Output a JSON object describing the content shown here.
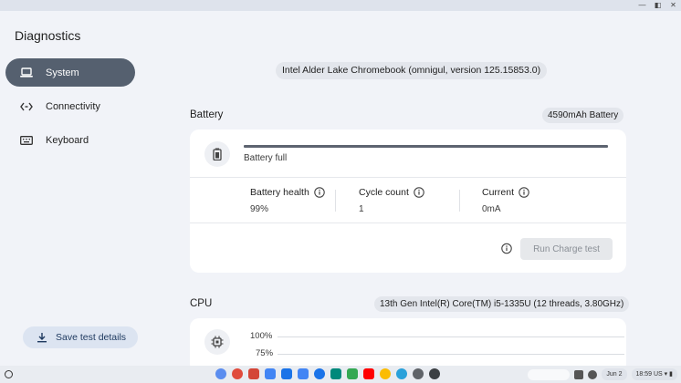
{
  "window": {
    "controls": [
      "—",
      "◧",
      "✕"
    ]
  },
  "app": {
    "title": "Diagnostics"
  },
  "sidebar": {
    "items": [
      {
        "label": "System",
        "icon": "laptop-icon",
        "active": true
      },
      {
        "label": "Connectivity",
        "icon": "code-arrows-icon",
        "active": false
      },
      {
        "label": "Keyboard",
        "icon": "keyboard-icon",
        "active": false
      }
    ],
    "save_label": "Save test details"
  },
  "device": {
    "name": "Intel Alder Lake Chromebook",
    "meta": "(omnigul, version 125.15853.0)"
  },
  "battery": {
    "title": "Battery",
    "capacity": "4590mAh Battery",
    "charge_fraction": 1.0,
    "status": "Battery full",
    "health_label": "Battery health",
    "health_value": "99%",
    "cycle_label": "Cycle count",
    "cycle_value": "1",
    "current_label": "Current",
    "current_value": "0mA",
    "run_label": "Run Charge test"
  },
  "cpu": {
    "title": "CPU",
    "model": "13th Gen Intel(R) Core(TM) i5-1335U (12 threads, 3.80GHz)",
    "gridlines": [
      "100%",
      "75%"
    ]
  },
  "shelf": {
    "apps": [
      {
        "name": "assistant-app-icon",
        "color": "#5b8def",
        "circle": true
      },
      {
        "name": "chrome-app-icon",
        "color": "#e04b3c",
        "circle": true
      },
      {
        "name": "gmail-app-icon",
        "color": "#d44638",
        "circle": false
      },
      {
        "name": "calendar-app-icon",
        "color": "#4285f4",
        "circle": false
      },
      {
        "name": "files-app-icon",
        "color": "#1a73e8",
        "circle": false
      },
      {
        "name": "docs-app-icon",
        "color": "#4285f4",
        "circle": false
      },
      {
        "name": "messages-app-icon",
        "color": "#1a73e8",
        "circle": true
      },
      {
        "name": "meet-app-icon",
        "color": "#00897b",
        "circle": false
      },
      {
        "name": "play-store-app-icon",
        "color": "#34a853",
        "circle": false
      },
      {
        "name": "youtube-app-icon",
        "color": "#ff0000",
        "circle": false
      },
      {
        "name": "photos-app-icon",
        "color": "#fbbc04",
        "circle": true
      },
      {
        "name": "telegram-app-icon",
        "color": "#2aa1da",
        "circle": true
      },
      {
        "name": "settings-app-icon",
        "color": "#5f6368",
        "circle": true
      },
      {
        "name": "diagnostics-app-icon",
        "color": "#3c4043",
        "circle": true
      }
    ],
    "date": "Jun 2",
    "time": "18:59 US"
  }
}
